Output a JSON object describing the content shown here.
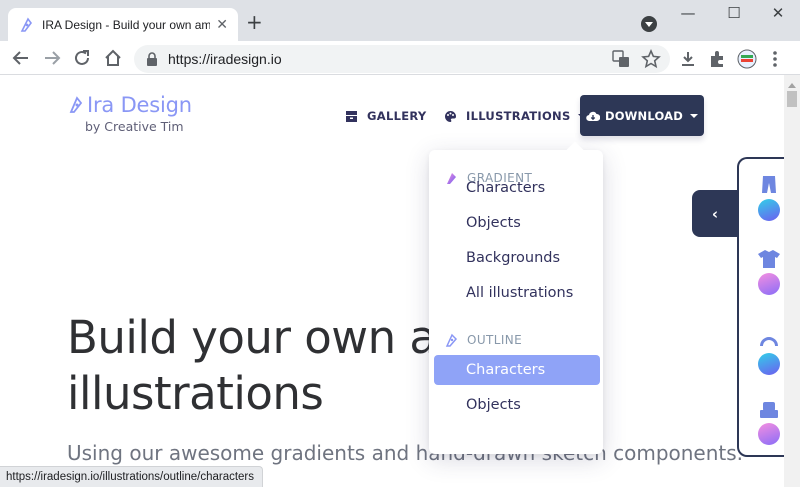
{
  "browser": {
    "tab_title": "IRA Design - Build your own am",
    "tab_close": "✕",
    "new_tab": "+",
    "url": "https://iradesign.io",
    "window_controls": [
      "—",
      "☐",
      "✕"
    ]
  },
  "page": {
    "brand_name": "Ira Design",
    "brand_by": "by Creative Tim",
    "nav": {
      "gallery": "GALLERY",
      "illustrations": "ILLUSTRATIONS",
      "download": "DOWNLOAD"
    },
    "dropdown": {
      "gradient_header": "GRADIENT",
      "gradient_items": [
        "Characters",
        "Objects",
        "Backgrounds",
        "All illustrations"
      ],
      "outline_header": "OUTLINE",
      "outline_items": [
        "Characters",
        "Objects"
      ],
      "active_item": "Characters"
    },
    "hero": {
      "title_line1": "Build your own an",
      "title_line2": "illustrations",
      "subtitle": "Using our awesome gradients and hand-drawn sketch components."
    },
    "side_panel": {
      "toggle_icon": "‹",
      "items": [
        "pants-icon",
        "shirt-icon",
        "hair-icon",
        "object-icon"
      ]
    }
  },
  "status_url": "https://iradesign.io/illustrations/outline/characters",
  "colors": {
    "brand": "#8a97f5",
    "dark": "#2d3756",
    "active": "#8fa3f7"
  }
}
